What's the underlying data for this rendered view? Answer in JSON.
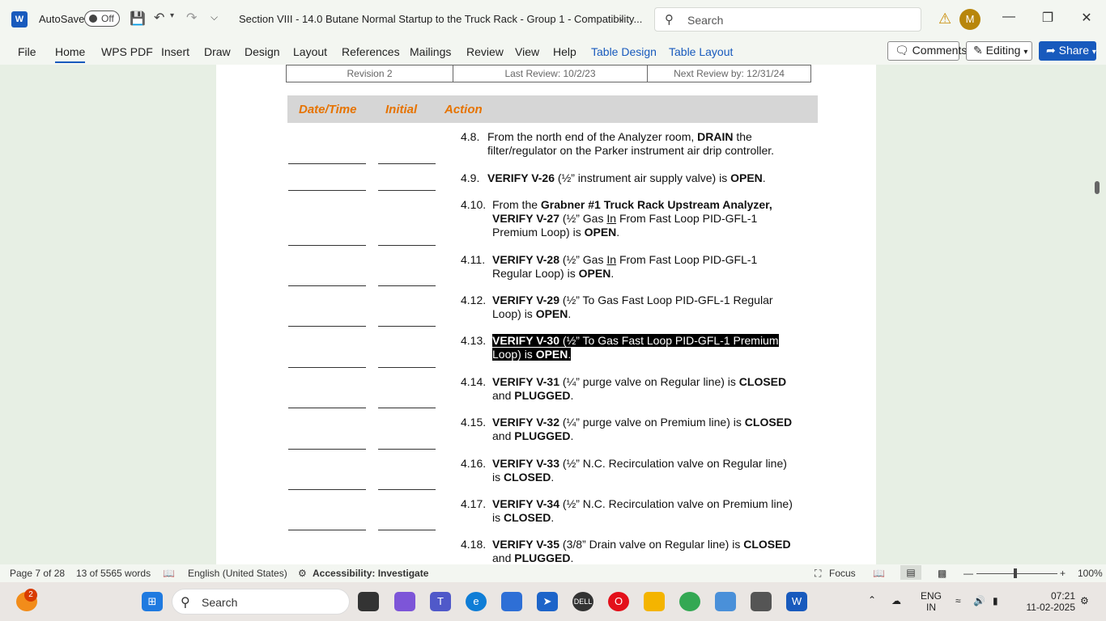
{
  "titlebar": {
    "autosave_label": "AutoSave",
    "autosave_state": "Off",
    "doc_title": "Section VIII - 14.0 Butane Normal Startup to the Truck Rack - Group 1  -  Compatibility...",
    "search_placeholder": "Search",
    "avatar_initial": "M"
  },
  "ribbon": {
    "tabs": [
      "File",
      "Home",
      "WPS PDF",
      "Insert",
      "Draw",
      "Design",
      "Layout",
      "References",
      "Mailings",
      "Review",
      "View",
      "Help",
      "Table Design",
      "Table Layout"
    ],
    "comments_label": "Comments",
    "editing_label": "Editing",
    "share_label": "Share"
  },
  "document": {
    "revision": "Revision 2",
    "last_review": "Last Review: 10/2/23",
    "next_review": "Next Review by: 12/31/24",
    "col_datetime": "Date/Time",
    "col_initial": "Initial",
    "col_action": "Action",
    "steps": [
      {
        "num": "4.8.",
        "l1a": "From the north end of the Analyzer room, ",
        "l1b": "DRAIN",
        "l1c": " the",
        "l2": "filter/regulator on the Parker instrument air drip controller."
      },
      {
        "num": "4.9.",
        "l1a": "VERIFY V-26",
        "l1b": " (½” instrument air supply valve) is ",
        "l1c": "OPEN",
        "l1d": "."
      },
      {
        "num": "4.10.",
        "l1a": "From the ",
        "l1b": "Grabner #1 Truck Rack Upstream Analyzer,",
        "l2a": "VERIFY V-27",
        "l2b": " (½” Gas ",
        "l2c": "In",
        "l2d": " From Fast Loop PID-GFL-1",
        "l3a": "Premium Loop) is ",
        "l3b": "OPEN",
        "l3c": "."
      },
      {
        "num": "4.11.",
        "l1a": "VERIFY V-28",
        "l1b": " (½” Gas ",
        "l1c": "In",
        "l1d": " From Fast Loop PID-GFL-1",
        "l2a": "Regular Loop) is ",
        "l2b": "OPEN",
        "l2c": "."
      },
      {
        "num": "4.12.",
        "l1a": "VERIFY V-29",
        "l1b": " (½” To Gas Fast Loop PID-GFL-1 Regular",
        "l2a": "Loop) is ",
        "l2b": "OPEN",
        "l2c": "."
      },
      {
        "num": "4.13.",
        "l1a": "VERIFY V-30",
        "l1b": " (½” To Gas Fast Loop PID-GFL-1 Premium",
        "l2a": "Loop) is ",
        "l2b": "OPEN",
        "l2c": "."
      },
      {
        "num": "4.14.",
        "l1a": "VERIFY V-31",
        "l1b": " (¼” purge valve on Regular line) is ",
        "l1c": "CLOSED",
        "l2a": "and ",
        "l2b": "PLUGGED",
        "l2c": "."
      },
      {
        "num": "4.15.",
        "l1a": "VERIFY V-32",
        "l1b": " (¼” purge valve on Premium line) is ",
        "l1c": "CLOSED",
        "l2a": "and ",
        "l2b": "PLUGGED",
        "l2c": "."
      },
      {
        "num": "4.16.",
        "l1a": "VERIFY V-33",
        "l1b": " (½” N.C. Recirculation valve on Regular line)",
        "l2a": "is ",
        "l2b": "CLOSED",
        "l2c": "."
      },
      {
        "num": "4.17.",
        "l1a": "VERIFY V-34",
        "l1b": " (½” N.C. Recirculation valve on Premium line)",
        "l2a": "is ",
        "l2b": "CLOSED",
        "l2c": "."
      },
      {
        "num": "4.18.",
        "l1a": "VERIFY V-35",
        "l1b": " (3/8” Drain valve on Regular line) is ",
        "l1c": "CLOSED",
        "l2a": "and ",
        "l2b": "PLUGGED",
        "l2c": "."
      }
    ]
  },
  "statusbar": {
    "page": "Page 7 of 28",
    "words": "13 of 5565 words",
    "language": "English (United States)",
    "accessibility": "Accessibility: Investigate",
    "focus": "Focus",
    "zoom": "100%"
  },
  "taskbar": {
    "search_label": "Search",
    "notif_count": "2",
    "lang1": "ENG",
    "lang2": "IN",
    "time": "07:21",
    "date": "11-02-2025"
  }
}
